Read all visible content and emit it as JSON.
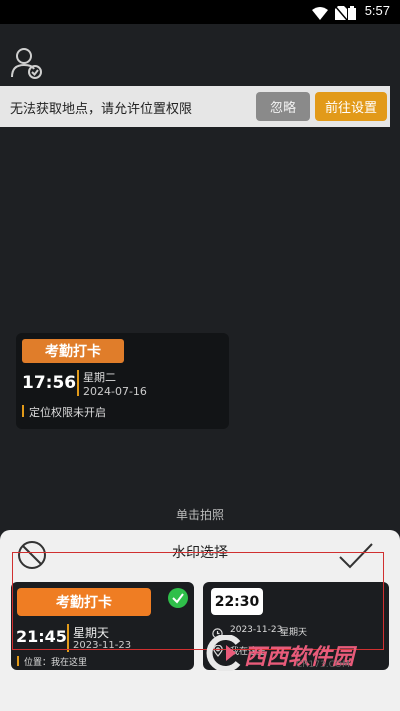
{
  "status_bar": {
    "time": "5:57",
    "icons": [
      "wifi-icon",
      "no-sim-icon",
      "battery-icon"
    ]
  },
  "banner": {
    "message": "无法获取地点，请允许位置权限",
    "ignore_label": "忽略",
    "goto_settings_label": "前往设置"
  },
  "preview": {
    "title": "考勤打卡",
    "time": "17:56",
    "weekday": "星期二",
    "date": "2024-07-16",
    "location_status": "定位权限未开启"
  },
  "shutter_hint": "单击拍照",
  "sheet": {
    "title": "水印选择",
    "options": [
      {
        "title": "考勤打卡",
        "time": "21:45",
        "weekday": "星期天",
        "date": "2023-11-23",
        "location": "位置：我在这里",
        "selected": true
      },
      {
        "time": "22:30",
        "date": "2023-11-23",
        "weekday": "星期天",
        "location": "我在这里",
        "selected": false
      }
    ]
  },
  "logo": {
    "main": "西西软件园",
    "sub": "CR173.COM"
  },
  "colors": {
    "accent": "#e29a19",
    "title_orange": "#ef7d23",
    "selected_check": "#2fbf4a",
    "background": "#1e2023"
  }
}
